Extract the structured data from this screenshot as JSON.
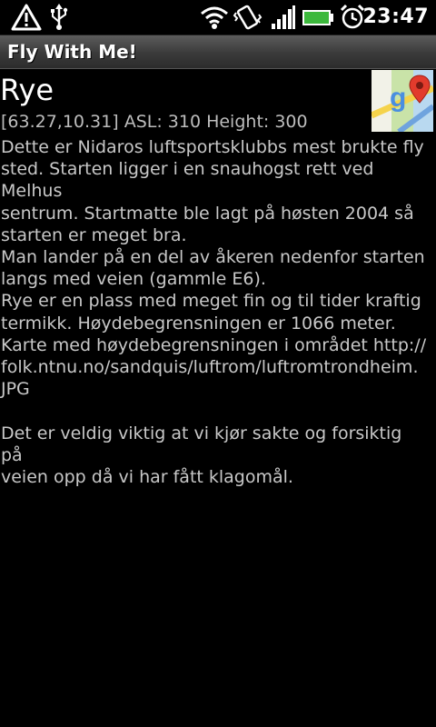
{
  "status_bar": {
    "time": "23:47",
    "icons": [
      "warning-icon",
      "usb-icon",
      "wifi-icon",
      "vibrate-icon",
      "signal-icon",
      "battery-icon",
      "alarm-icon"
    ],
    "battery_color": "#3cb83c"
  },
  "app": {
    "title": "Fly With Me!"
  },
  "place": {
    "name": "Rye",
    "info": "[63.27,10.31] ASL: 310 Height: 300",
    "description": "Dette er Nidaros luftsportsklubbs mest brukte fly\nsted. Starten ligger i en snauhogst rett ved Melhus\nsentrum. Startmatte ble lagt på høsten 2004 så\nstarten er meget bra.\nMan lander på en del av åkeren nedenfor starten\nlangs med veien (gammle E6).\nRye er en plass med meget fin og til tider kraftig\ntermikk. Høydebegrensningen er 1066 meter.\nKarte med høydebegrensningen i området http://\nfolk.ntnu.no/sandquis/luftrom/luftromtrondheim.\nJPG\n\nDet er veldig viktig at vi kjør sakte og forsiktig på\nveien opp då vi har fått klagomål.",
    "map_icon": "google-maps-icon"
  }
}
